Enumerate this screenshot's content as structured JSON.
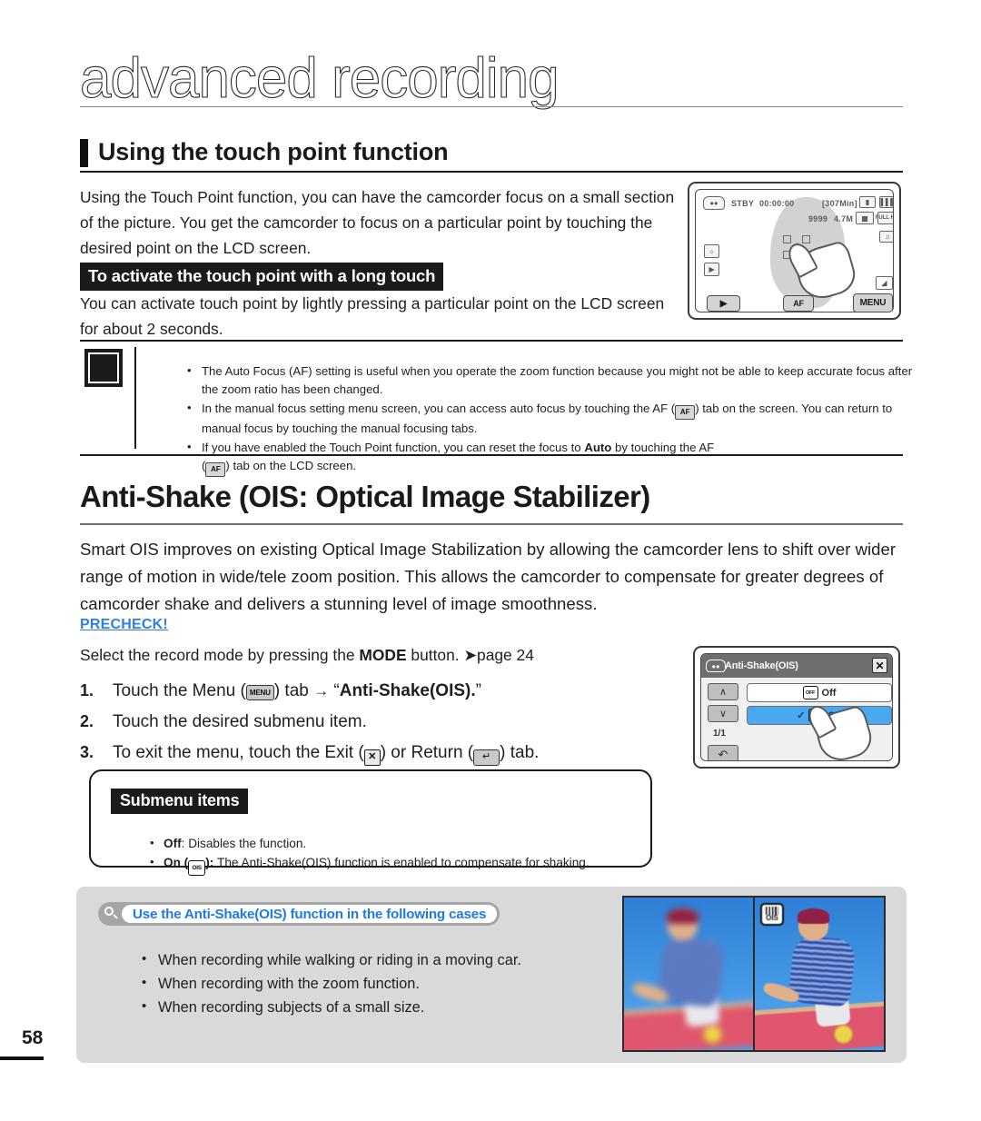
{
  "page": {
    "chapter_title": "advanced recording",
    "page_number": "58"
  },
  "section1": {
    "heading": "Using the touch point function",
    "intro": "Using the Touch Point function, you can have the camcorder focus on a small section of the picture. You get the camcorder to focus on a particular point by touching the desired point on the LCD screen.",
    "sub_heading": "To activate the touch point with a long touch",
    "sub_body": "You can activate touch point by lightly pressing a particular point on the LCD screen for about 2 seconds."
  },
  "lcd_recording": {
    "status": "STBY",
    "timecode": "00:00:00",
    "remaining": "[307Min]",
    "photo_count": "9999",
    "resolution": "4.7M",
    "quality": "FULL HD",
    "play_tab": "play-icon",
    "af_tab": "AF",
    "menu_tab": "MENU"
  },
  "note_box": {
    "icon": "note-hand-icon",
    "items": [
      "The Auto Focus (AF) setting is useful when you operate the zoom function because you might not be able to keep accurate focus after the zoom ratio has been changed.",
      "In the manual focus setting menu screen, you can access auto focus by touching the AF ( ) tab on the screen. You can return to manual focus by touching the manual focusing tabs.",
      "If you have enabled the Touch Point function, you can reset the focus to Auto by touching the AF ( ) tab on the LCD screen."
    ]
  },
  "section2": {
    "heading": "Anti-Shake (OIS: Optical Image Stabilizer)",
    "intro": "Smart OIS improves on existing Optical Image Stabilization by allowing the camcorder lens to shift over wider range of motion in wide/tele zoom position. This allows the camcorder to compensate for greater degrees of camcorder shake and delivers a stunning level of image smoothness.",
    "precheck_label": "PRECHECK!",
    "precheck_body_a": "Select the record mode by pressing the ",
    "precheck_body_b": "MODE",
    "precheck_body_c": " button. ",
    "precheck_page_ref": "page 24",
    "steps": [
      {
        "num": "1.",
        "a": "Touch the Menu (",
        "icon": "MENU",
        "b": ") tab ",
        "arrow": "→",
        "c": " “",
        "bold": "Anti-Shake(OIS).",
        "d": "”"
      },
      {
        "num": "2.",
        "a": "Touch the desired submenu item."
      },
      {
        "num": "3.",
        "a": "To exit the menu, touch the Exit (",
        "icon_x": "✕",
        "b": ") or Return (",
        "icon_ret": "↵",
        "c": ") tab."
      }
    ]
  },
  "lcd_menu": {
    "title": "Anti-Shake(OIS)",
    "close_icon": "✕",
    "up_icon": "∧",
    "down_icon": "∨",
    "return_icon": "↶",
    "page_indicator": "1/1",
    "options": [
      {
        "label": "Off",
        "selected": false,
        "icon": "ois-off-icon"
      },
      {
        "label": "On",
        "selected": true,
        "icon": "ois-on-icon",
        "check": "✓"
      }
    ]
  },
  "submenu_box": {
    "title": "Submenu items",
    "items": [
      {
        "name": "Off",
        "sep": ": ",
        "desc": "Disables the function."
      },
      {
        "name": "On",
        "icon": "OIS",
        "sep": "): ",
        "desc": "The Anti-Shake(OIS) function is enabled to compensate for shaking."
      }
    ]
  },
  "cases_panel": {
    "pill_icon": "magnifier-icon",
    "pill_label": "Use the Anti-Shake(OIS) function in the following cases",
    "pill_text_color": "#1e7ae8",
    "items": [
      "When recording while walking or riding in a moving car.",
      "When recording with the zoom function.",
      "When recording subjects of a small size."
    ],
    "photos": [
      {
        "caption": "blurry-skateboarder-photo",
        "badge": null
      },
      {
        "caption": "sharp-skateboarder-photo",
        "badge": "OIS"
      }
    ]
  }
}
